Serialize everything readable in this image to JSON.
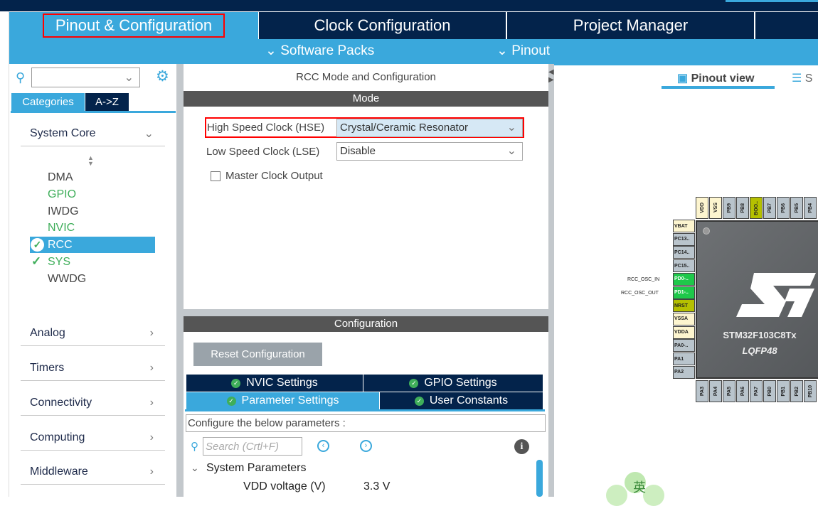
{
  "top_tabs": [
    {
      "label": "Pinout & Configuration"
    },
    {
      "label": "Clock Configuration"
    },
    {
      "label": "Project Manager"
    }
  ],
  "sub_menu": [
    {
      "label": "Software Packs"
    },
    {
      "label": "Pinout"
    }
  ],
  "sidebar": {
    "search_value": "",
    "tabs": [
      {
        "label": "Categories"
      },
      {
        "label": "A->Z"
      }
    ],
    "categories": [
      {
        "label": "System Core"
      },
      {
        "label": "Analog"
      },
      {
        "label": "Timers"
      },
      {
        "label": "Connectivity"
      },
      {
        "label": "Computing"
      },
      {
        "label": "Middleware"
      }
    ],
    "system_core_items": [
      {
        "label": "DMA",
        "state": "normal"
      },
      {
        "label": "GPIO",
        "state": "configured"
      },
      {
        "label": "IWDG",
        "state": "normal"
      },
      {
        "label": "NVIC",
        "state": "configured"
      },
      {
        "label": "RCC",
        "state": "selected"
      },
      {
        "label": "SYS",
        "state": "checked"
      },
      {
        "label": "WWDG",
        "state": "normal"
      }
    ]
  },
  "main": {
    "title": "RCC Mode and Configuration",
    "mode_header": "Mode",
    "hse_label": "High Speed Clock (HSE)",
    "hse_value": "Crystal/Ceramic Resonator",
    "lse_label": "Low Speed Clock (LSE)",
    "lse_value": "Disable",
    "mco_label": "Master Clock Output",
    "mco_checked": false,
    "config_header": "Configuration",
    "reset_button": "Reset Configuration",
    "config_tabs": [
      {
        "label": "NVIC Settings"
      },
      {
        "label": "GPIO Settings"
      },
      {
        "label": "Parameter Settings",
        "active": true
      },
      {
        "label": "User Constants"
      }
    ],
    "configure_text": "Configure the below parameters :",
    "search_placeholder": "Search (Crtl+F)",
    "group": "System Parameters",
    "params": [
      {
        "name": "VDD voltage (V)",
        "value": "3.3 V"
      }
    ]
  },
  "right": {
    "view_tabs": [
      {
        "label": "Pinout view"
      },
      {
        "label": "S"
      }
    ],
    "chip_name": "STM32F103C8Tx",
    "package": "LQFP48",
    "signal_labels": [
      "RCC_OSC_IN",
      "RCC_OSC_OUT"
    ],
    "top_pins": [
      {
        "n": "VDD",
        "c": "#fdf5cf"
      },
      {
        "n": "VSS",
        "c": "#fdf5cf"
      },
      {
        "n": "PB9",
        "c": "#b9c4cc"
      },
      {
        "n": "PB8",
        "c": "#b9c4cc"
      },
      {
        "n": "BOO..",
        "c": "#b5c000"
      },
      {
        "n": "PB7",
        "c": "#b9c4cc"
      },
      {
        "n": "PB6",
        "c": "#b9c4cc"
      },
      {
        "n": "PB5",
        "c": "#b9c4cc"
      },
      {
        "n": "PB4",
        "c": "#b9c4cc"
      }
    ],
    "left_pins": [
      {
        "n": "VBAT",
        "c": "#fdf5cf"
      },
      {
        "n": "PC13..",
        "c": "#b9c4cc"
      },
      {
        "n": "PC14..",
        "c": "#b9c4cc"
      },
      {
        "n": "PC15..",
        "c": "#b9c4cc"
      },
      {
        "n": "PD0-..",
        "c": "#1ec84a"
      },
      {
        "n": "PD1-..",
        "c": "#1ec84a"
      },
      {
        "n": "NRST",
        "c": "#b5c000"
      },
      {
        "n": "VSSA",
        "c": "#fdf5cf"
      },
      {
        "n": "VDDA",
        "c": "#fdf5cf"
      },
      {
        "n": "PA0-..",
        "c": "#b9c4cc"
      },
      {
        "n": "PA1",
        "c": "#b9c4cc"
      },
      {
        "n": "PA2",
        "c": "#b9c4cc"
      }
    ],
    "bottom_pins": [
      {
        "n": "PA3",
        "c": "#b9c4cc"
      },
      {
        "n": "PA4",
        "c": "#b9c4cc"
      },
      {
        "n": "PA5",
        "c": "#b9c4cc"
      },
      {
        "n": "PA6",
        "c": "#b9c4cc"
      },
      {
        "n": "PA7",
        "c": "#b9c4cc"
      },
      {
        "n": "PB0",
        "c": "#b9c4cc"
      },
      {
        "n": "PB1",
        "c": "#b9c4cc"
      },
      {
        "n": "PB2",
        "c": "#b9c4cc"
      },
      {
        "n": "PB10",
        "c": "#b9c4cc"
      }
    ],
    "watermark_char": "英"
  },
  "colors": {
    "accent": "#3aa8dc",
    "navy": "#03234b",
    "highlight": "#ff0000",
    "configured": "#3fae5a"
  }
}
